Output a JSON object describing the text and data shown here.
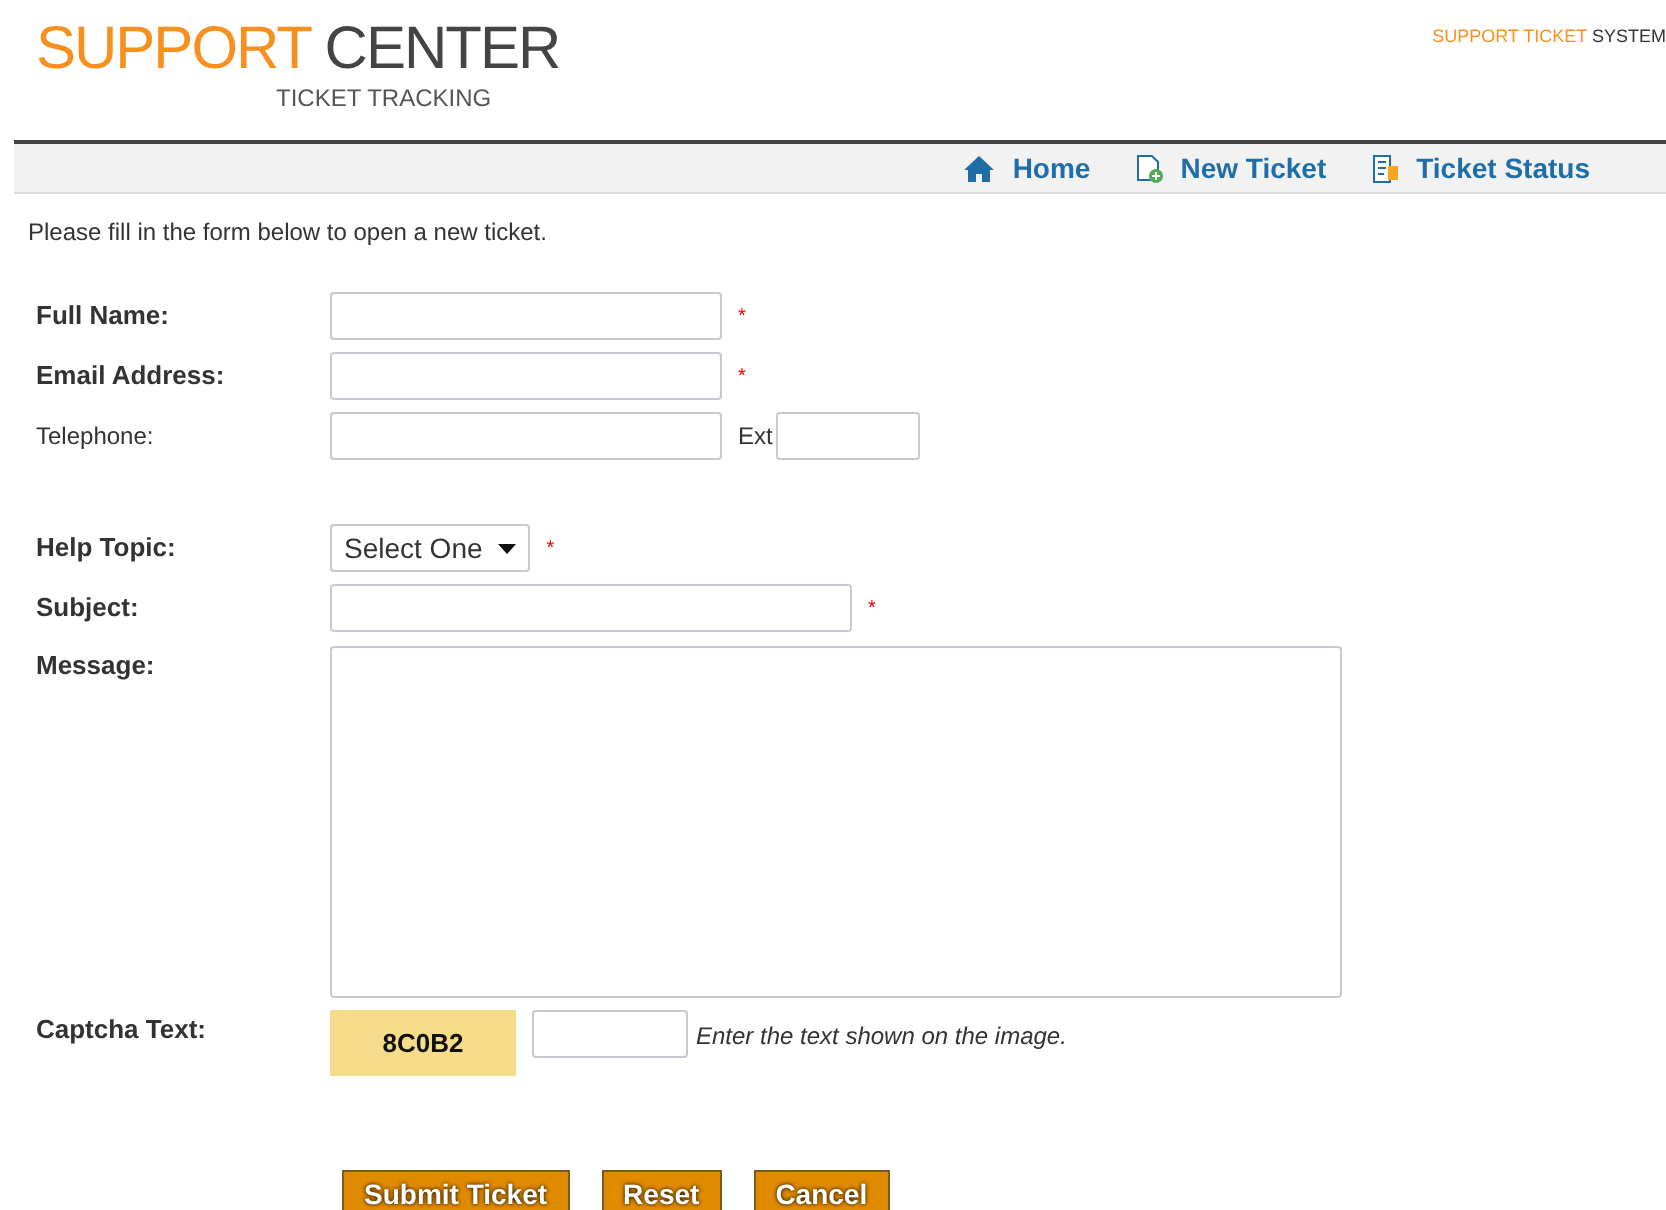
{
  "header": {
    "logo_main": "SUPPORT",
    "logo_accent": "CENTER",
    "logo_sub": "TICKET TRACKING",
    "system_accent": "SUPPORT TICKET",
    "system": "SYSTEM"
  },
  "nav": [
    {
      "label": "Home"
    },
    {
      "label": "New Ticket"
    },
    {
      "label": "Ticket Status"
    }
  ],
  "required_mark": "*",
  "intro": "Please fill in the form below to open a new ticket.",
  "fields": [
    {
      "label": "Full Name:",
      "kind": "text",
      "required": true,
      "bold": true
    },
    {
      "label": "Email Address:",
      "kind": "text",
      "required": true,
      "bold": true
    },
    {
      "label": "Telephone:",
      "kind": "phone",
      "required": false,
      "bold": false,
      "ext_label": "Ext"
    },
    {
      "kind": "spacer"
    },
    {
      "label": "Help Topic:",
      "kind": "select",
      "required": true,
      "bold": true,
      "value": "Select One"
    },
    {
      "label": "Subject:",
      "kind": "wide",
      "required": true,
      "bold": true
    },
    {
      "label": "Message:",
      "kind": "textarea",
      "required": false,
      "bold": true
    }
  ],
  "captcha": {
    "label": "Captcha Text:",
    "code": "8C0B2",
    "hint": "Enter the text shown on the image."
  },
  "buttons": [
    "Submit Ticket",
    "Reset",
    "Cancel"
  ]
}
